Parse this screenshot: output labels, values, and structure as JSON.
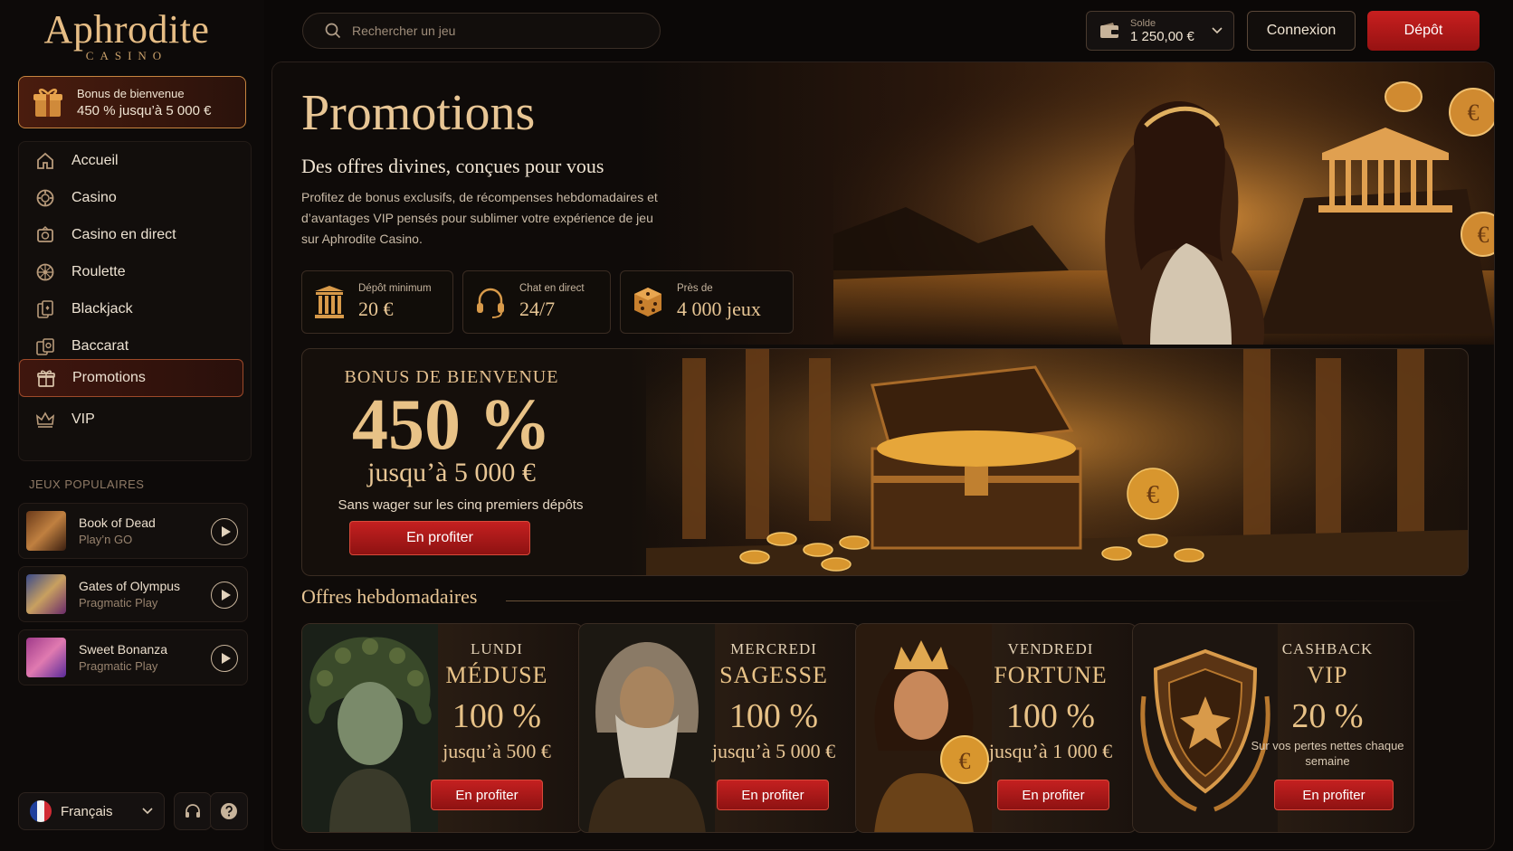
{
  "logo": {
    "name": "Aphrodite",
    "sub": "CASINO"
  },
  "welcome": {
    "line1": "Bonus de bienvenue",
    "line2": "450 % jusqu’à 5 000 €"
  },
  "nav": {
    "items": [
      {
        "label": "Accueil",
        "icon": "home-icon"
      },
      {
        "label": "Casino",
        "icon": "chip-icon"
      },
      {
        "label": "Casino en direct",
        "icon": "live-casino-icon"
      },
      {
        "label": "Roulette",
        "icon": "roulette-icon"
      },
      {
        "label": "Blackjack",
        "icon": "cards-icon"
      },
      {
        "label": "Baccarat",
        "icon": "baccarat-icon"
      },
      {
        "label": "Promotions",
        "icon": "gift-icon",
        "active": true
      },
      {
        "label": "VIP",
        "icon": "crown-icon"
      }
    ]
  },
  "popular": {
    "title": "JEUX POPULAIRES",
    "games": [
      {
        "name": "Book of Dead",
        "provider": "Play’n GO"
      },
      {
        "name": "Gates of Olympus",
        "provider": "Pragmatic Play"
      },
      {
        "name": "Sweet Bonanza",
        "provider": "Pragmatic Play"
      }
    ]
  },
  "language": "Français",
  "search": {
    "placeholder": "Rechercher un jeu"
  },
  "balance": {
    "label": "Solde",
    "value": "1 250,00 €"
  },
  "buttons": {
    "login": "Connexion",
    "deposit": "Dépôt"
  },
  "hero": {
    "title": "Promotions",
    "subtitle": "Des offres divines, conçues pour vous",
    "description": "Profitez de bonus exclusifs, de récompenses hebdomadaires et d’avantages VIP pensés pour sublimer votre expérience de jeu sur Aphrodite Casino.",
    "stats": [
      {
        "label": "Dépôt minimum",
        "value": "20 €",
        "icon": "column-icon"
      },
      {
        "label": "Chat en direct",
        "value": "24/7",
        "icon": "headset-icon"
      },
      {
        "label": "Près de",
        "value": "4 000 jeux",
        "icon": "dice-icon"
      }
    ]
  },
  "bonus": {
    "label": "BONUS DE BIENVENUE",
    "amount": "450 %",
    "upto": "jusqu’à 5 000 €",
    "note": "Sans wager sur les cinq premiers dépôts",
    "cta": "En profiter"
  },
  "weekly": {
    "title": "Offres hebdomadaires",
    "cards": [
      {
        "day": "LUNDI",
        "name": "MÉDUSE",
        "percent": "100 %",
        "upto": "jusqu’à 500 €",
        "cta": "En profiter"
      },
      {
        "day": "MERCREDI",
        "name": "SAGESSE",
        "percent": "100 %",
        "upto": "jusqu’à 5 000 €",
        "cta": "En profiter"
      },
      {
        "day": "VENDREDI",
        "name": "FORTUNE",
        "percent": "100 %",
        "upto": "jusqu’à 1 000 €",
        "cta": "En profiter"
      },
      {
        "day": "CASHBACK",
        "name": "VIP",
        "percent": "20 %",
        "note": "Sur vos pertes nettes chaque semaine",
        "cta": "En profiter"
      }
    ]
  },
  "colors": {
    "accent": "#e8c287",
    "deposit": "#c81f1f",
    "background": "#0b0807"
  }
}
